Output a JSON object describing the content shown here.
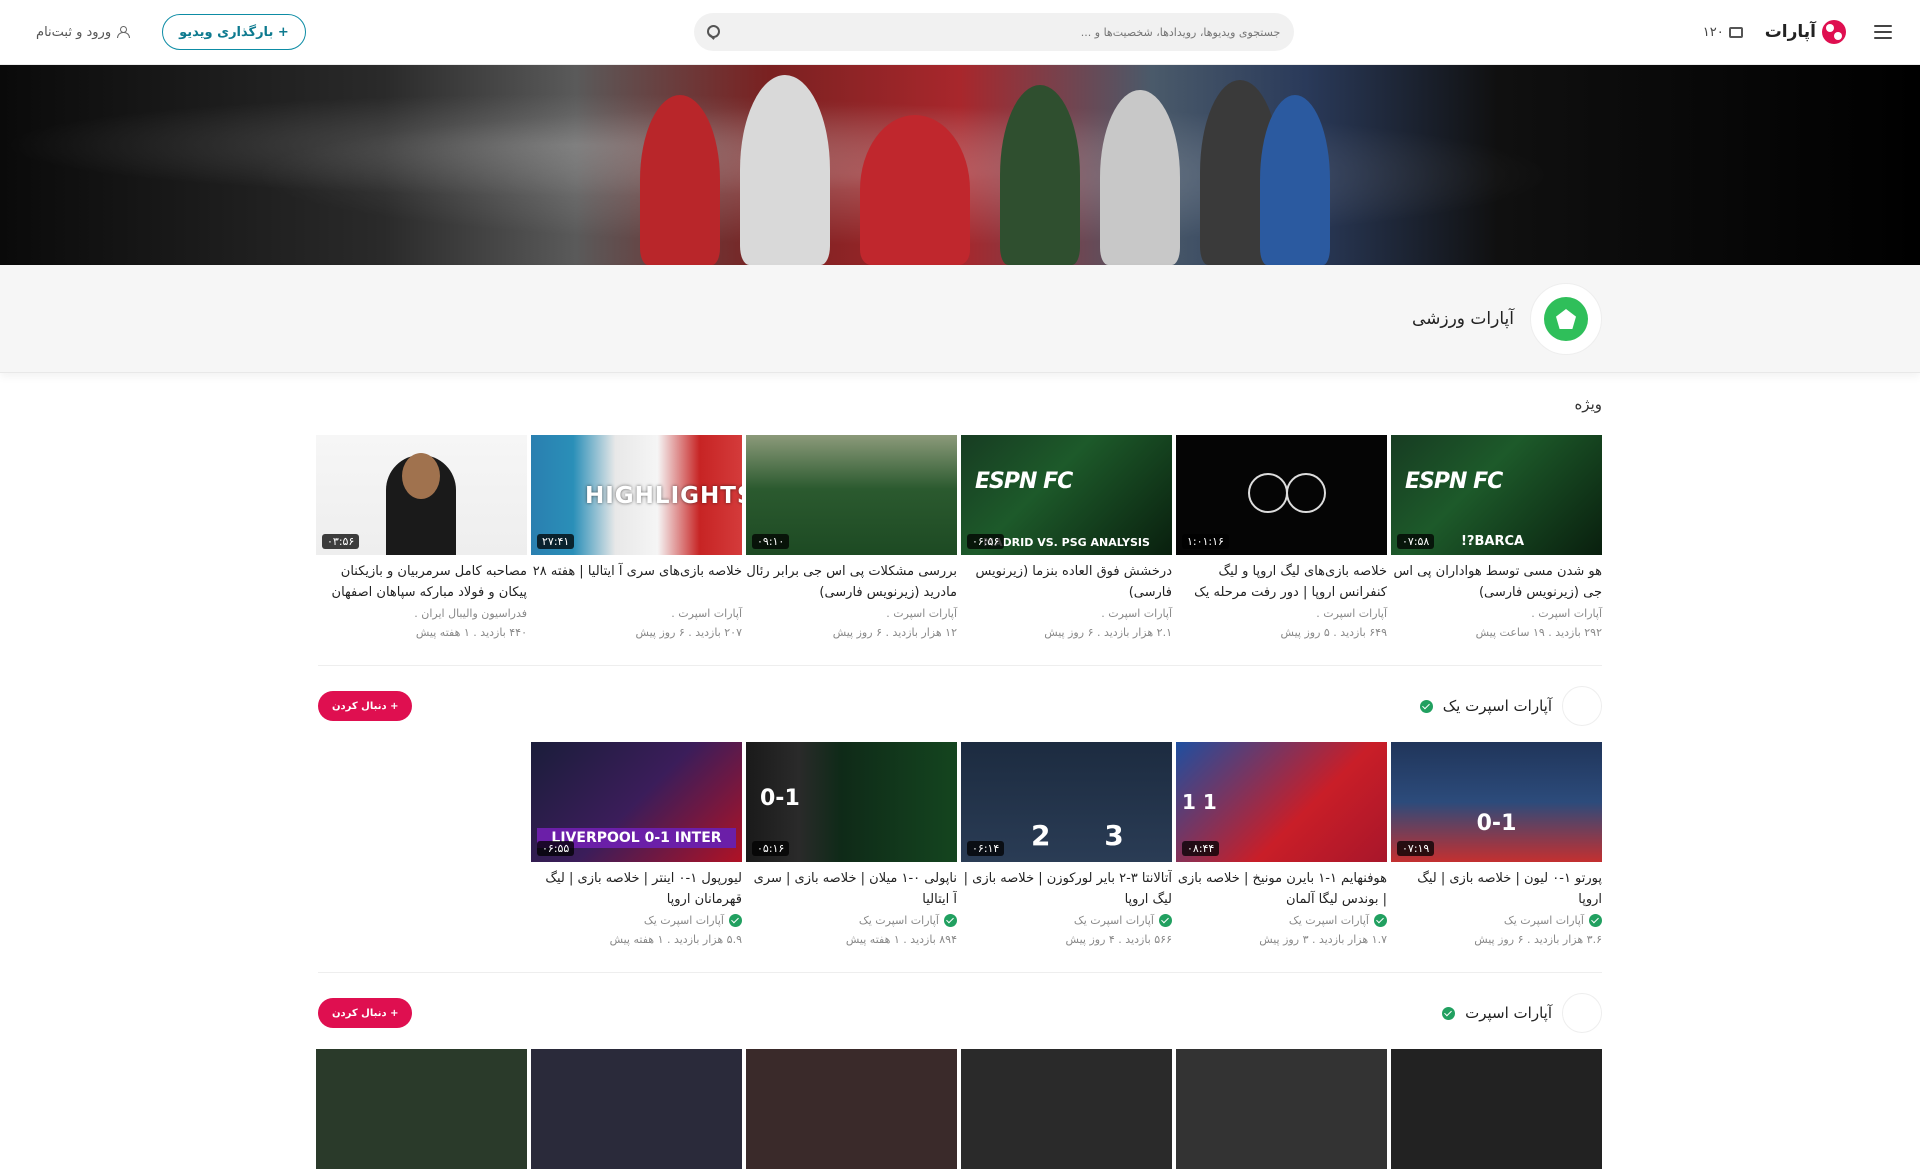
{
  "header": {
    "menu_icon": "hamburger-icon",
    "logo_text": "آپارات",
    "credit": "۱۲۰",
    "search_placeholder": "جستجوی ویدیوها، رویدادها، شخصیت‌ها و ...",
    "upload_label": "+ بارگذاری ویدیو",
    "login_label": "ورود و ثبت‌نام"
  },
  "channel": {
    "name": "آپارات ورزشی"
  },
  "featured": {
    "title": "ویژه",
    "videos": [
      {
        "title": "هو شدن مسی توسط هواداران پی اس جی (زیرنویس فارسی)",
        "channel": "آپارات اسپرت .",
        "meta": "۲۹۲ بازدید . ۱۹ ساعت پیش",
        "duration": "۰۷:۵۸",
        "label": "BARCA?!"
      },
      {
        "title": "خلاصه بازی‌های لیگ اروپا و لیگ کنفرانس اروپا | دور رفت مرحله یک",
        "channel": "آپارات اسپرت .",
        "meta": "۶۴۹ بازدید . ۵ روز پیش",
        "duration": "۱:۰۱:۱۶",
        "label": ""
      },
      {
        "title": "درخشش فوق العاده بنزما (زیرنویس فارسی)",
        "channel": "آپارات اسپرت .",
        "meta": "۲.۱ هزار بازدید . ۶ روز پیش",
        "duration": "۰۶:۵۶",
        "label": "MADRID VS. PSG ANALYSIS"
      },
      {
        "title": "بررسی مشکلات پی اس جی برابر رئال مادرید (زیرنویس فارسی)",
        "channel": "آپارات اسپرت .",
        "meta": "۱۲ هزار بازدید . ۶ روز پیش",
        "duration": "۰۹:۱۰",
        "label": ""
      },
      {
        "title": "خلاصه بازی‌های سری آ ایتالیا | هفته ۲۸",
        "channel": "آپارات اسپرت .",
        "meta": "۲۰۷ بازدید . ۶ روز پیش",
        "duration": "۲۷:۴۱",
        "label": "HIGHLIGHTS"
      },
      {
        "title": "مصاحبه کامل سرمربیان و بازیکنان پیکان و فولاد مبارکه سپاهان اصفهان",
        "channel": "فدراسیون والیبال ایران .",
        "meta": "۴۴۰ بازدید . ۱ هفته پیش",
        "duration": "۰۳:۵۶",
        "label": ""
      }
    ]
  },
  "sections": [
    {
      "name": "آپارات اسپرت یک",
      "follow_label": "+ دنبال کردن",
      "videos": [
        {
          "title": "پورتو ۱-۰ لیون | خلاصه بازی | لیگ اروپا",
          "channel": "آپارات اسپرت یک",
          "meta": "۳.۶ هزار بازدید . ۶ روز پیش",
          "duration": "۰۷:۱۹",
          "label": "0-1"
        },
        {
          "title": "هوفنهایم ۱-۱ بایرن مونیخ | خلاصه بازی | بوندس لیگا آلمان",
          "channel": "آپارات اسپرت یک",
          "meta": "۱.۷ هزار بازدید . ۳ روز پیش",
          "duration": "۰۸:۴۴",
          "label": "1 1"
        },
        {
          "title": "آتالانتا ۳-۲ بایر لورکوزن | خلاصه بازی | لیگ اروپا",
          "channel": "آپارات اسپرت یک",
          "meta": "۵۶۶ بازدید . ۴ روز پیش",
          "duration": "۰۶:۱۴",
          "label": "3 2"
        },
        {
          "title": "ناپولی ۰-۱ میلان | خلاصه بازی | سری آ ایتالیا",
          "channel": "آپارات اسپرت یک",
          "meta": "۸۹۴ بازدید . ۱ هفته پیش",
          "duration": "۰۵:۱۶",
          "label": "0-1"
        },
        {
          "title": "لیورپول ۱-۰ اینتر | خلاصه بازی | لیگ قهرمانان اروپا",
          "channel": "آپارات اسپرت یک",
          "meta": "۵.۹ هزار بازدید . ۱ هفته پیش",
          "duration": "۰۶:۵۵",
          "label": "LIVERPOOL 0-1 INTER"
        }
      ]
    },
    {
      "name": "آپارات اسپرت",
      "follow_label": "+ دنبال کردن",
      "videos": []
    }
  ]
}
